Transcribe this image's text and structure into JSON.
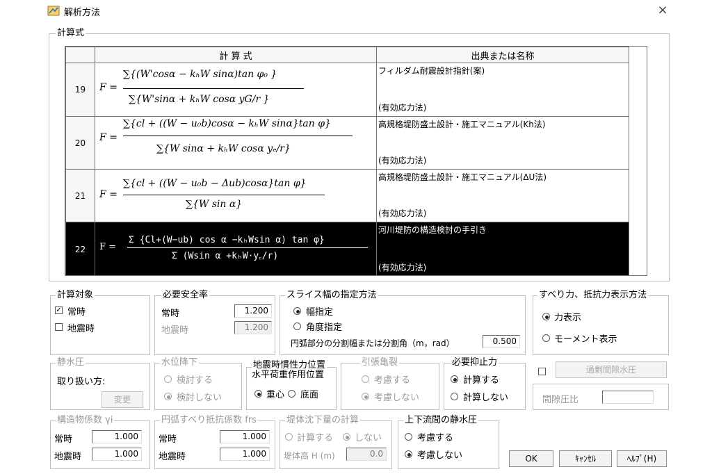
{
  "window": {
    "title": "解析方法",
    "close": "×"
  },
  "formula_group": {
    "label": "計算式",
    "col_formula": "計 算 式",
    "col_source": "出典または名称",
    "rows": [
      {
        "no": "19",
        "source1": "フィルダム耐震設計指針(案)",
        "source2": "(有効応力法)"
      },
      {
        "no": "20",
        "source1": "高規格堤防盛土設計・施工マニュアル(Kh法)",
        "source2": "(有効応力法)"
      },
      {
        "no": "21",
        "source1": "高規格堤防盛土設計・施工マニュアル(ΔU法)",
        "source2": "(有効応力法)"
      },
      {
        "no": "22",
        "source1": "河川堤防の構造検討の手引き",
        "source2": "(有効応力法)"
      }
    ],
    "formulas": {
      "f19_num": "∑{(W'cosα − kₕW sinα)tan φ₀ }",
      "f19_den": "∑{W'sinα + kₕW cosα yG/r }",
      "f20_num": "∑{cl + ((W − u₀b)cosα − kₕW sinα}tan φ}",
      "f20_den": "∑{W sinα + kₕW cosα yₑ/r}",
      "f21_num": "∑{cl + ((W − u₀b − Δub)cosα}tan φ}",
      "f21_den": "∑{W sin α}",
      "f22_num": "Σ {Cl+(W−ub) cos α −kₕWsin α) tan φ}",
      "f22_den": "Σ (Wsin α +kₕW·y꜀/r)",
      "lhs": "F ="
    }
  },
  "target": {
    "label": "計算対象",
    "normal": "常時",
    "quake": "地震時",
    "normal_checked": true,
    "quake_checked": false
  },
  "safety": {
    "label": "必要安全率",
    "normal": "常時",
    "quake": "地震時",
    "normal_value": "1.200",
    "quake_value": "1.200"
  },
  "slice": {
    "label": "スライス幅の指定方法",
    "opt1": "幅指定",
    "opt2": "角度指定",
    "division_label": "円弧部分の分割幅または分割角（m，rad）",
    "division_value": "0.500"
  },
  "force": {
    "label": "すべり力、抵抗力表示方法",
    "opt1": "力表示",
    "opt2": "モーメント表示"
  },
  "water": {
    "label": "静水圧",
    "handling": "取り扱い方:",
    "change": "変更"
  },
  "level": {
    "label": "水位降下",
    "opt1": "検討する",
    "opt2": "検討しない"
  },
  "inertia": {
    "label1": "地震時慣性力位置",
    "label2": "水平荷重作用位置",
    "opt1": "重心",
    "opt2": "底面"
  },
  "crack": {
    "label": "引張亀裂",
    "opt1": "考慮する",
    "opt2": "考慮しない"
  },
  "restraint": {
    "label": "必要抑止力",
    "opt1": "計算する",
    "opt2": "計算しない"
  },
  "pore": {
    "excess_button": "過剰間隙水圧",
    "ratio_label": "間隙圧比",
    "ratio_value": ""
  },
  "struct": {
    "label": "構造物係数 γi",
    "normal": "常時",
    "quake": "地震時",
    "normal_value": "1.000",
    "quake_value": "1.000"
  },
  "arc": {
    "label": "円弧すべり抵抗係数 frs",
    "normal": "常時",
    "quake": "地震時",
    "normal_value": "1.000",
    "quake_value": "1.000"
  },
  "settle": {
    "label": "堤体沈下量の計算",
    "opt1": "計算する",
    "opt2": "しない",
    "height_label": "堤体高 H (m)",
    "height_value": "0.0"
  },
  "hydro": {
    "label": "上下流間の静水圧",
    "opt1": "考慮する",
    "opt2": "考慮しない"
  },
  "buttons": {
    "ok": "OK",
    "cancel": "ｷｬﾝｾﾙ",
    "help": "ﾍﾙﾌﾟ(H)"
  },
  "colors": {
    "selected_row": "#000000",
    "disabled_text": "#9a9a9a",
    "border": "#bdbdbd"
  }
}
